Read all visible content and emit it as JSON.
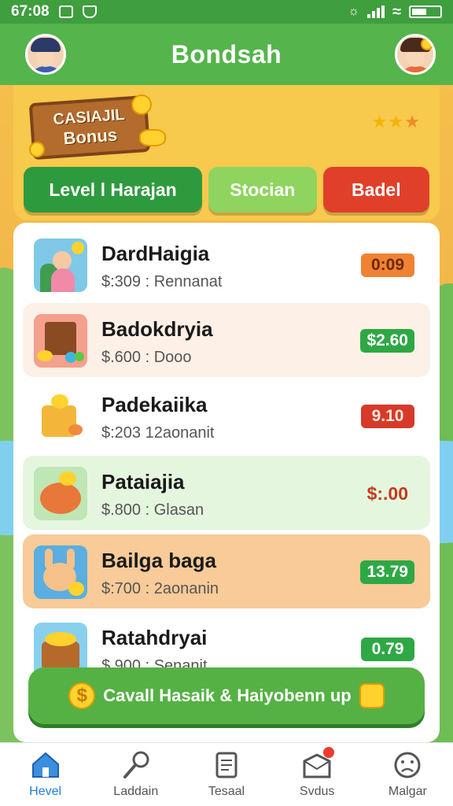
{
  "status_bar": {
    "time": "67:08"
  },
  "header": {
    "title": "Bondsah"
  },
  "bonus": {
    "sign_line1": "CASIAJIL",
    "sign_line2": "Bonus",
    "stars": 3,
    "tabs": [
      "Level l Harajan",
      "Stocian",
      "Badel"
    ]
  },
  "items": [
    {
      "title": "DardHaigia",
      "subtitle": "$:309 : Rennanat",
      "price": "0:09",
      "price_style": "orange",
      "bg": "#ffffff"
    },
    {
      "title": "Badokdryia",
      "subtitle": "$.600 : Dooo",
      "price": "$2.60",
      "price_style": "green",
      "bg": "#fdf0e6"
    },
    {
      "title": "Padekaiika",
      "subtitle": "$:203 12aonanit",
      "price": "9.10",
      "price_style": "red",
      "bg": "#ffffff"
    },
    {
      "title": "Pataiajia",
      "subtitle": "$.800 : Glasan",
      "price": "$:.00",
      "price_style": "plain",
      "bg": "#e5f6df"
    },
    {
      "title": "Bailga baga",
      "subtitle": "$:700 : 2aonanin",
      "price": "13.79",
      "price_style": "green",
      "bg": "#f8cb98"
    },
    {
      "title": "Ratahdryai",
      "subtitle": "$.900 : Senanit",
      "price": "0.79",
      "price_style": "green",
      "bg": "#ffffff"
    }
  ],
  "cta": {
    "label": "Cavall Hasaik & Haiyobenn up"
  },
  "nav": [
    {
      "label": "Hevel",
      "icon": "home-icon",
      "active": true
    },
    {
      "label": "Laddain",
      "icon": "microphone-icon",
      "active": false
    },
    {
      "label": "Tesaal",
      "icon": "document-icon",
      "active": false
    },
    {
      "label": "Svdus",
      "icon": "inbox-icon",
      "active": false,
      "badge": true
    },
    {
      "label": "Malgar",
      "icon": "sad-face-icon",
      "active": false
    }
  ],
  "colors": {
    "primary_green": "#55b44b",
    "tab_dark_green": "#2e9a3e",
    "tab_light_green": "#8fd45e",
    "tab_red": "#e0402a",
    "panel_yellow": "#f7c94d",
    "nav_active": "#1e7ed8"
  }
}
